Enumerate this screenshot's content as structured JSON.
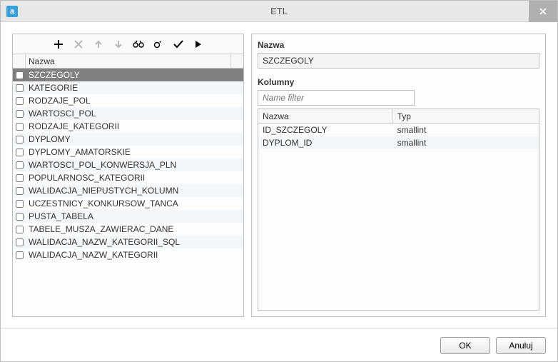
{
  "window": {
    "title": "ETL",
    "app_icon_letter": "a"
  },
  "left": {
    "header": "Nazwa",
    "rows": [
      {
        "name": "SZCZEGOLY",
        "selected": true
      },
      {
        "name": "KATEGORIE"
      },
      {
        "name": "RODZAJE_POL"
      },
      {
        "name": "WARTOSCI_POL"
      },
      {
        "name": "RODZAJE_KATEGORII"
      },
      {
        "name": "DYPLOMY"
      },
      {
        "name": "DYPLOMY_AMATORSKIE"
      },
      {
        "name": "WARTOSCI_POL_KONWERSJA_PLN"
      },
      {
        "name": "POPULARNOSC_KATEGORII"
      },
      {
        "name": "WALIDACJA_NIEPUSTYCH_KOLUMN"
      },
      {
        "name": "UCZESTNICY_KONKURSOW_TANCA"
      },
      {
        "name": "PUSTA_TABELA"
      },
      {
        "name": "TABELE_MUSZA_ZAWIERAC_DANE"
      },
      {
        "name": "WALIDACJA_NAZW_KATEGORII_SQL"
      },
      {
        "name": "WALIDACJA_NAZW_KATEGORII"
      }
    ]
  },
  "right": {
    "name_label": "Nazwa",
    "name_value": "SZCZEGOLY",
    "columns_label": "Kolumny",
    "filter_placeholder": "Name filter",
    "cols_header_name": "Nazwa",
    "cols_header_type": "Typ",
    "columns": [
      {
        "name": "ID_SZCZEGOLY",
        "type": "smallint"
      },
      {
        "name": "DYPLOM_ID",
        "type": "smallint"
      }
    ]
  },
  "footer": {
    "ok": "OK",
    "cancel": "Anuluj"
  }
}
